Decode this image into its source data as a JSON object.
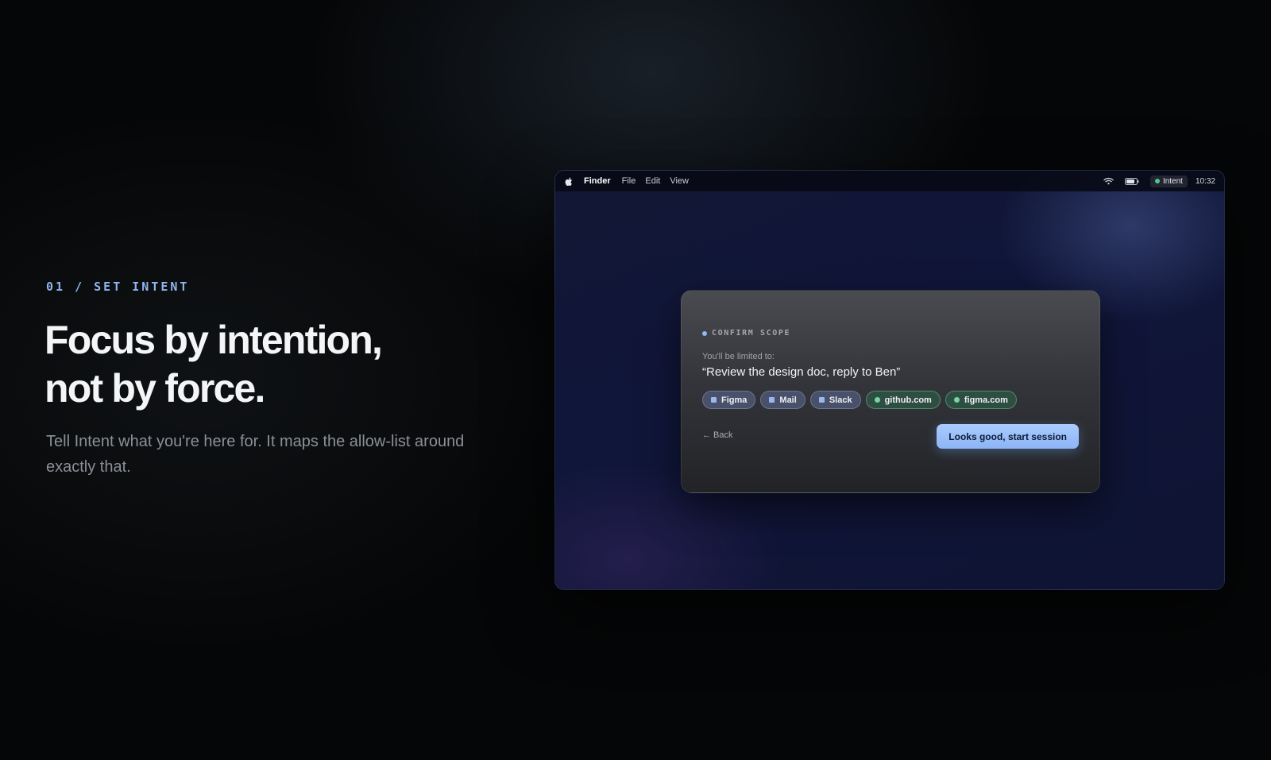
{
  "hero": {
    "eyebrow": "01 / SET INTENT",
    "headline_line1": "Focus by intention,",
    "headline_line2": "not by force.",
    "subcopy": "Tell Intent what you're here for. It maps the allow-list around exactly that."
  },
  "menubar": {
    "apple_icon": "apple-icon",
    "app_name": "Finder",
    "menus": [
      "File",
      "Edit",
      "View"
    ],
    "wifi_icon": "wifi-icon",
    "battery_icon": "battery-icon",
    "intent_label": "Intent",
    "clock": "10:32"
  },
  "dialog": {
    "label": "CONFIRM SCOPE",
    "limited_text": "You'll be limited to:",
    "intent_quote": "“Review the design doc, reply to Ben”",
    "chips": [
      {
        "label": "Figma",
        "kind": "app"
      },
      {
        "label": "Mail",
        "kind": "app"
      },
      {
        "label": "Slack",
        "kind": "app"
      },
      {
        "label": "github.com",
        "kind": "site"
      },
      {
        "label": "figma.com",
        "kind": "site"
      }
    ],
    "back_label": "Back",
    "back_icon": "arrow-left-icon",
    "start_label": "Looks good, start session"
  },
  "colors": {
    "accent": "#8fb5ee",
    "button": "#9cc0fa",
    "site_chip": "#72d6a2",
    "status_dot": "#4ec88a"
  }
}
